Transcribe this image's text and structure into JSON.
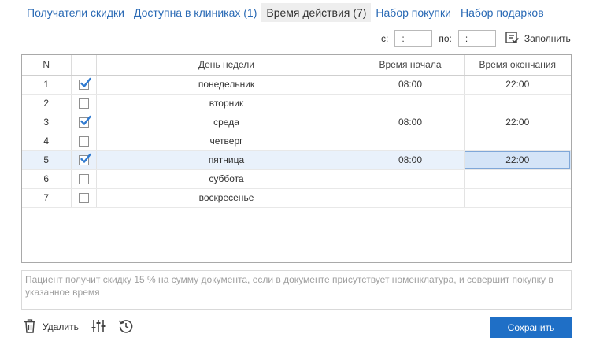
{
  "tabs": [
    {
      "label": "Получатели скидки",
      "active": false
    },
    {
      "label": "Доступна в клиниках (1)",
      "active": false
    },
    {
      "label": "Время действия (7)",
      "active": true
    },
    {
      "label": "Набор покупки",
      "active": false
    },
    {
      "label": "Набор подарков",
      "active": false
    }
  ],
  "range": {
    "from_label": "с:",
    "from_value": ":",
    "to_label": "по:",
    "to_value": ":",
    "fill_label": "Заполнить"
  },
  "grid": {
    "columns": [
      "N",
      "",
      "День недели",
      "Время начала",
      "Время окончания"
    ],
    "rows": [
      {
        "n": "1",
        "checked": true,
        "day": "понедельник",
        "start": "08:00",
        "end": "22:00"
      },
      {
        "n": "2",
        "checked": false,
        "day": "вторник",
        "start": "",
        "end": ""
      },
      {
        "n": "3",
        "checked": true,
        "day": "среда",
        "start": "08:00",
        "end": "22:00"
      },
      {
        "n": "4",
        "checked": false,
        "day": "четверг",
        "start": "",
        "end": ""
      },
      {
        "n": "5",
        "checked": true,
        "day": "пятница",
        "start": "08:00",
        "end": "22:00",
        "selected": true
      },
      {
        "n": "6",
        "checked": false,
        "day": "суббота",
        "start": "",
        "end": ""
      },
      {
        "n": "7",
        "checked": false,
        "day": "воскресенье",
        "start": "",
        "end": ""
      }
    ]
  },
  "note": "Пациент получит скидку 15 % на сумму документа, если в документе присутствует номенклатура, и совершит покупку в указанное время",
  "toolbar": {
    "delete_label": "Удалить",
    "delete_icon": "trash-icon",
    "settings_icon": "sliders-icon",
    "history_icon": "history-icon",
    "fill_icon": "checklist-icon"
  },
  "save_label": "Сохранить",
  "colors": {
    "accent": "#1f6fc6",
    "link": "#2a6ab5",
    "selected_row": "#e9f1fb",
    "check": "#2f7ad0"
  }
}
